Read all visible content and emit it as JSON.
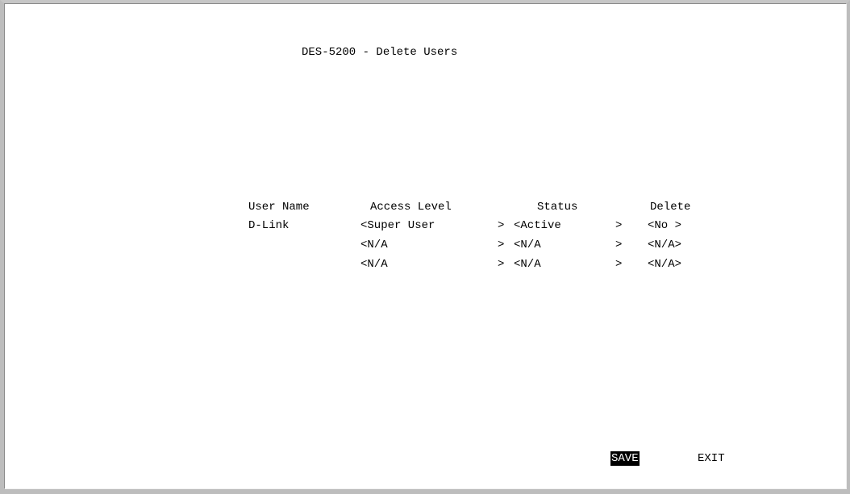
{
  "title": "DES-5200 - Delete Users",
  "table": {
    "headers": {
      "user_name": "User Name",
      "access_level": "Access Level",
      "status": "Status",
      "delete": "Delete"
    },
    "rows": [
      {
        "user_name": "D-Link",
        "access_level": "<Super User",
        "status": "<Active",
        "delete": "<No >"
      },
      {
        "user_name": "",
        "access_level": "<N/A",
        "status": "<N/A",
        "delete": "<N/A>"
      },
      {
        "user_name": "",
        "access_level": "<N/A",
        "status": "<N/A",
        "delete": "<N/A>"
      }
    ],
    "field_close": ">"
  },
  "buttons": {
    "save": "SAVE",
    "exit": "EXIT"
  }
}
